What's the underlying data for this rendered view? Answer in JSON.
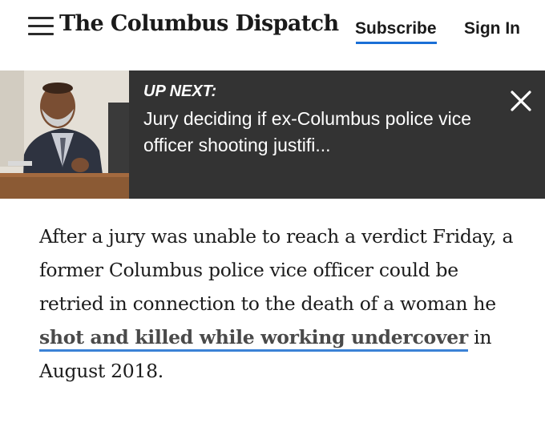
{
  "header": {
    "logo": "The Columbus Dispatch",
    "subscribe_label": "Subscribe",
    "signin_label": "Sign In",
    "accent_color": "#1a6fd6"
  },
  "up_next": {
    "kicker": "UP NEXT:",
    "headline": "Jury deciding if ex-Columbus police vice officer shooting justifi...",
    "background_color": "#333333"
  },
  "article": {
    "text_before_link": "After a jury was unable to reach a verdict Friday, a former Columbus police vice officer could be retried in connection to the death of a woman he ",
    "link_text": "shot and killed while working undercover",
    "text_after_link": " in August 2018."
  }
}
